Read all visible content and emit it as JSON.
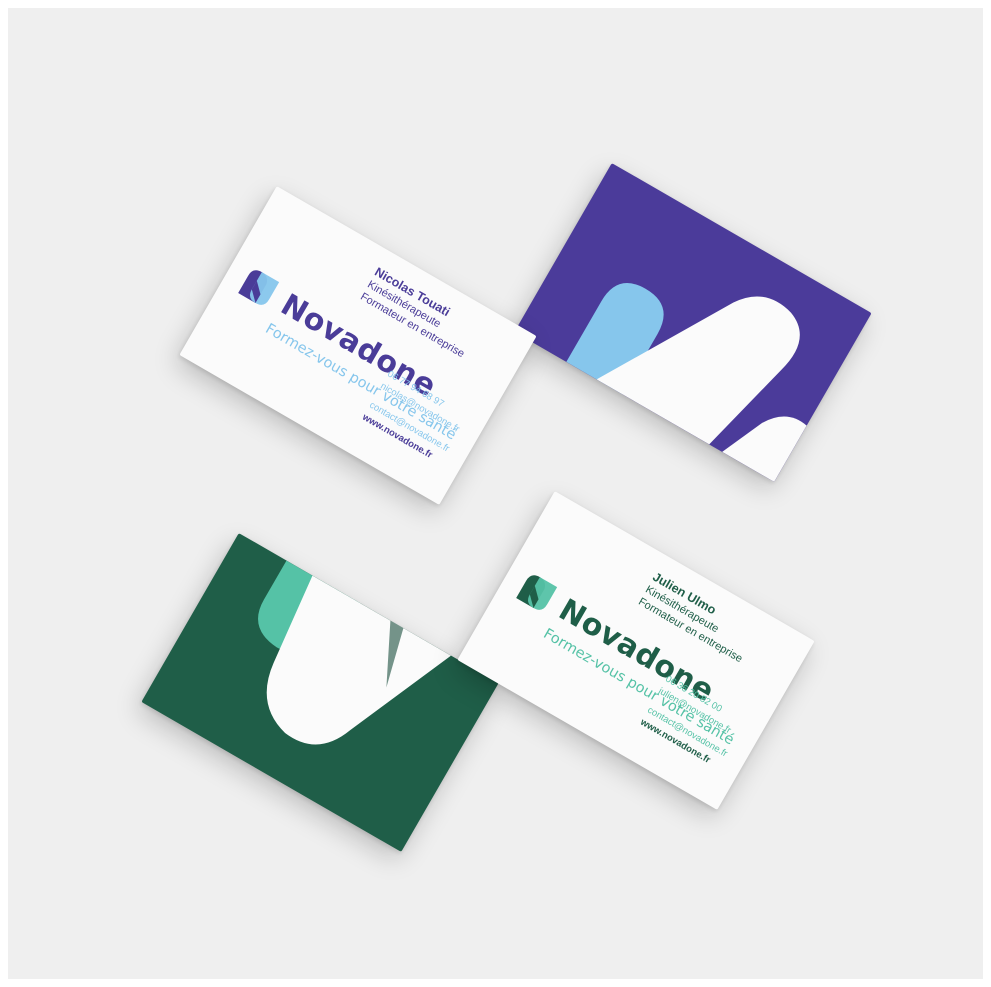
{
  "brand": {
    "name": "Novadone",
    "tagline": "Formez-vous pour votre santé",
    "colors": {
      "purple": "#4b3b9a",
      "light_blue": "#86c6ec",
      "dark_green": "#1f5e48",
      "mint": "#55c2a6",
      "card_white": "#fbfbfb",
      "background": "#efefef"
    }
  },
  "cards": {
    "nicolas": {
      "name": "Nicolas Touati",
      "role1": "Kinésithérapeute",
      "role2": "Formateur en entreprise",
      "phone": "06 77 94 68 97",
      "email_personal": "nicolas@novadone.fr",
      "email_contact": "contact@novadone.fr",
      "website": "www.novadone.fr"
    },
    "julien": {
      "name": "Julien Ulmo",
      "role1": "Kinésithérapeute",
      "role2": "Formateur en entreprise",
      "phone": "06 36 20 82 00",
      "email_personal": "julien@novadone.fr",
      "email_contact": "contact@novadone.fr",
      "website": "www.novadone.fr"
    }
  },
  "icons": [
    "novadone-logo-icon"
  ]
}
